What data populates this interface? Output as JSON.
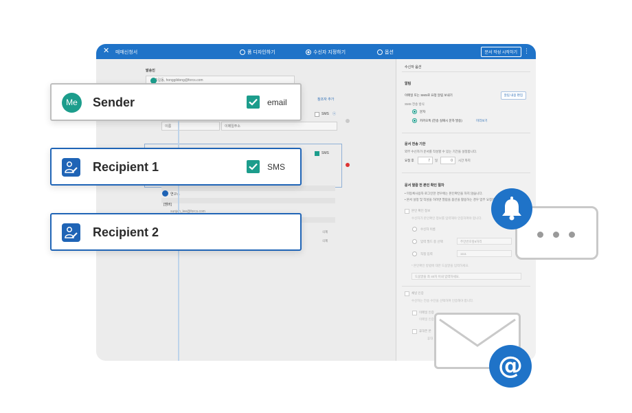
{
  "app": {
    "title": "매매신청서",
    "nav": [
      "폼 디자인하기",
      "수신자 지정하기",
      "옵션"
    ],
    "start_button": "문서 작성 시작하기"
  },
  "form": {
    "sender_section": "발송인",
    "sender_email": "홍길동, honggildong@forcs.com",
    "add_reviewer": "참조자 추가",
    "sms_label": "SMS",
    "name_placeholder": "이름",
    "email_placeholder": "이메일주소",
    "recipient_name": "연구소",
    "member_tag": "[멤버]",
    "recipient_email": "sunjeh_lee@forcs.com",
    "delete_label": "삭제"
  },
  "options_panel": {
    "title": "수신자 옵션",
    "notify_title": "알림",
    "notify_desc": "이메일 또는 SMS로 요청 알림 보내기",
    "edit_button": "알림 내용 편집",
    "sms_method": "SMS 전송 방식",
    "opt_text": "문자",
    "opt_kakao": "카카오톡 (전송 실패시 문자 발송)",
    "preview": "미리보기",
    "deadline_title": "문서 전송 기한",
    "deadline_desc": "외부 수신자가 문서를 작성할 수 있는 기간을 설정합니다.",
    "deadline_prefix": "요청 후",
    "days_value": "7",
    "days_unit": "일",
    "hours_value": "0",
    "hours_unit": "시간 까지",
    "verify_title": "문서 열람 전 본인 확인 절차",
    "verify_desc1": "• 미등록사용자 로그인한 경우에는 본인확인을 하지 않습니다.",
    "verify_desc2": "• 본서 설정 및 작성을 하려면 열람을 옵션을 활용하는 경우 업무 요청자",
    "verify_check": "본인 확인 정보",
    "verify_sub": "수신자가 본인확인 정보를 입력해야 인증하여야 합니다.",
    "verify_opt1": "수신자 이름",
    "verify_opt2": "입력 필드 중 선택",
    "verify_opt2_value": "주민번호앞6자리",
    "verify_opt3": "직접 입력",
    "verify_opt3_value": "1111",
    "verify_hint": "* 본인확인 방법에 대한 도움말을 입력하세요.",
    "verify_hint_placeholder": "도움말을 최 40자 이내 입력하세요.",
    "channel_title": "채널 인증",
    "channel_desc": "수신자는 전송 수단을 선택하여 인증해야 합니다.",
    "channel_email": "이메일 인증",
    "channel_email_sub": "이메일 인증",
    "channel_phone": "휴대폰 본",
    "channel_phone_sub": "휴대"
  },
  "cards": [
    {
      "avatar": "Me",
      "name": "Sender",
      "option": "email"
    },
    {
      "name": "Recipient 1",
      "option": "SMS"
    },
    {
      "name": "Recipient 2"
    }
  ],
  "colors": {
    "accent": "#1f73c8",
    "teal": "#1c9d8c",
    "card_border": "#1f64b6"
  }
}
